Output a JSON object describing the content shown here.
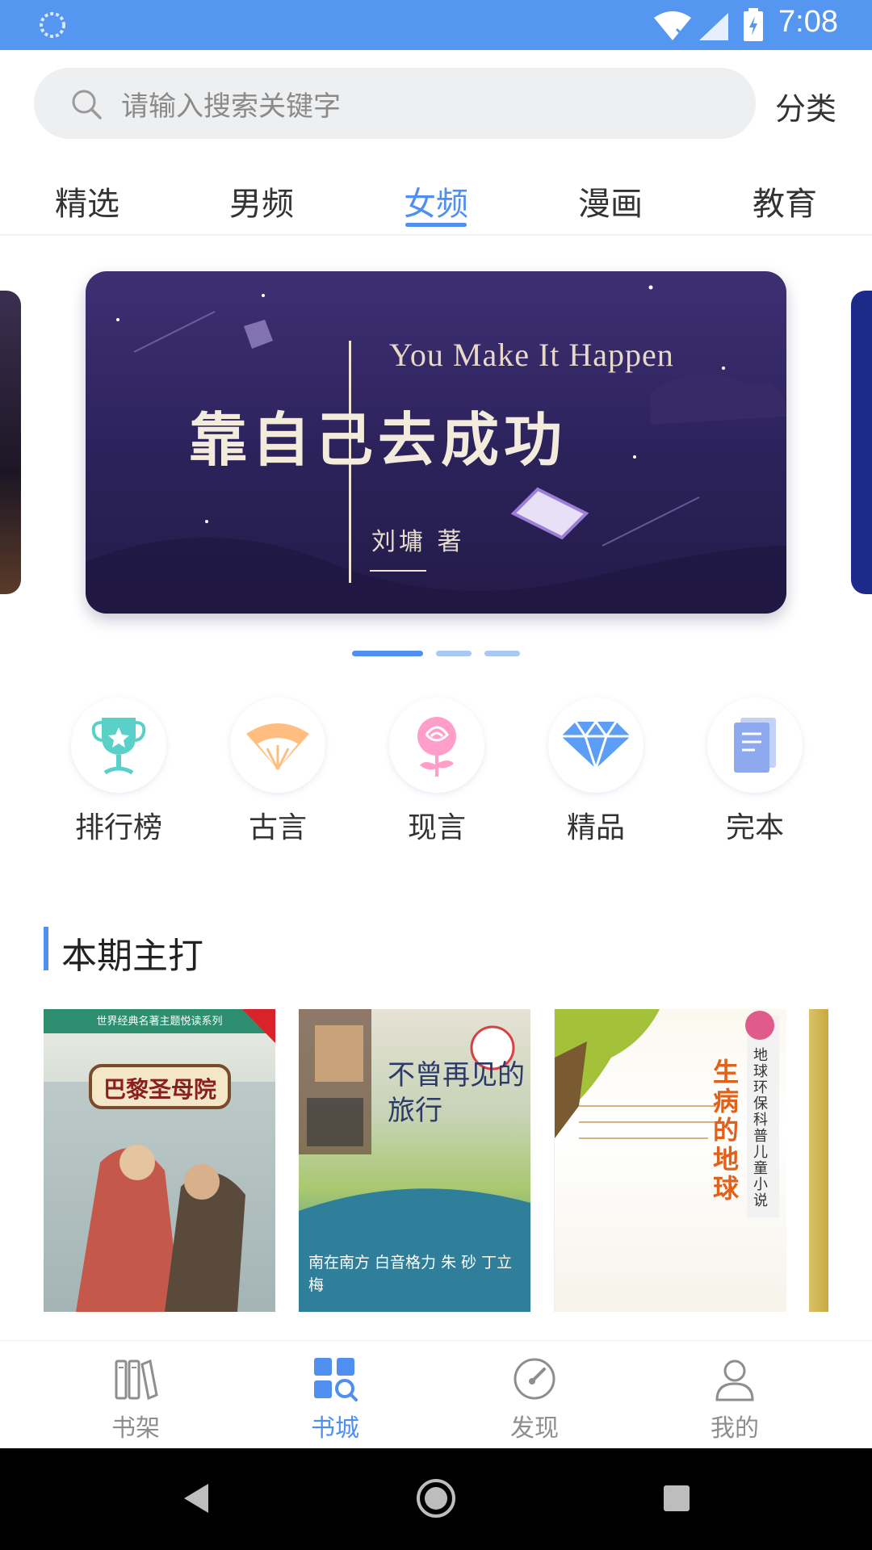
{
  "status_bar": {
    "time": "7:08",
    "background": "#5496f0",
    "icons": [
      "loading-icon",
      "wifi-icon",
      "signal-icon",
      "battery-icon"
    ]
  },
  "search": {
    "placeholder": "请输入搜索关键字",
    "category_link": "分类"
  },
  "tabs": {
    "items": [
      "精选",
      "男频",
      "女频",
      "漫画",
      "教育"
    ],
    "active": "女频"
  },
  "banner": {
    "subtitle": "You Make It Happen",
    "title": "靠自己去成功",
    "author": "刘墉  著",
    "page_count": 3,
    "active_page": 1
  },
  "categories": [
    {
      "label": "排行榜",
      "icon": "trophy-icon"
    },
    {
      "label": "古言",
      "icon": "fan-icon"
    },
    {
      "label": "现言",
      "icon": "rose-icon"
    },
    {
      "label": "精品",
      "icon": "diamond-icon"
    },
    {
      "label": "完本",
      "icon": "book-stack-icon"
    }
  ],
  "section": {
    "title": "本期主打"
  },
  "books": [
    {
      "cover_title": "巴黎圣母院",
      "series": "世界经典名著主题悦读系列"
    },
    {
      "cover_title": "不曾再见的旅行",
      "authors": "南在南方  白音格力  朱  砂  丁立梅"
    },
    {
      "cover_title": "生病的地球",
      "series": "地球环保科普儿童小说"
    }
  ],
  "bottom_nav": {
    "items": [
      {
        "label": "书架",
        "icon": "bookshelf-icon"
      },
      {
        "label": "书城",
        "icon": "bookstore-icon"
      },
      {
        "label": "发现",
        "icon": "discover-icon"
      },
      {
        "label": "我的",
        "icon": "profile-icon"
      }
    ],
    "active": "书城"
  },
  "colors": {
    "accent": "#4e8ff0",
    "status_bar": "#5496f0",
    "banner_bg": "#2b225a"
  }
}
